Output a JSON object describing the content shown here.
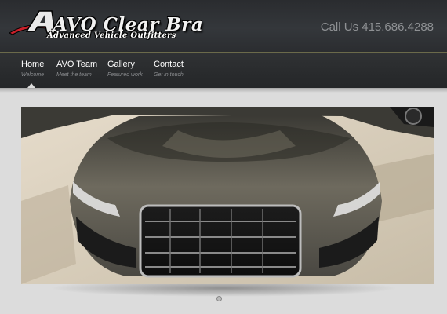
{
  "header": {
    "logo": {
      "title": "AVO Clear Bra",
      "subtitle": "Advanced Vehicle Outfitters"
    },
    "phone_text": "Call Us 415.686.4288"
  },
  "nav": {
    "items": [
      {
        "label": "Home",
        "subtitle": "Welcome"
      },
      {
        "label": "AVO Team",
        "subtitle": "Meet the team"
      },
      {
        "label": "Gallery",
        "subtitle": "Featured work"
      },
      {
        "label": "Contact",
        "subtitle": "Get in touch"
      }
    ],
    "active_index": 0
  },
  "colors": {
    "header_bg": "#2f3134",
    "accent_red": "#c9202a",
    "page_bg": "#dcdcdc"
  },
  "hero": {
    "image_subject": "car-photo",
    "slides_count": 1,
    "current_slide": 1
  }
}
